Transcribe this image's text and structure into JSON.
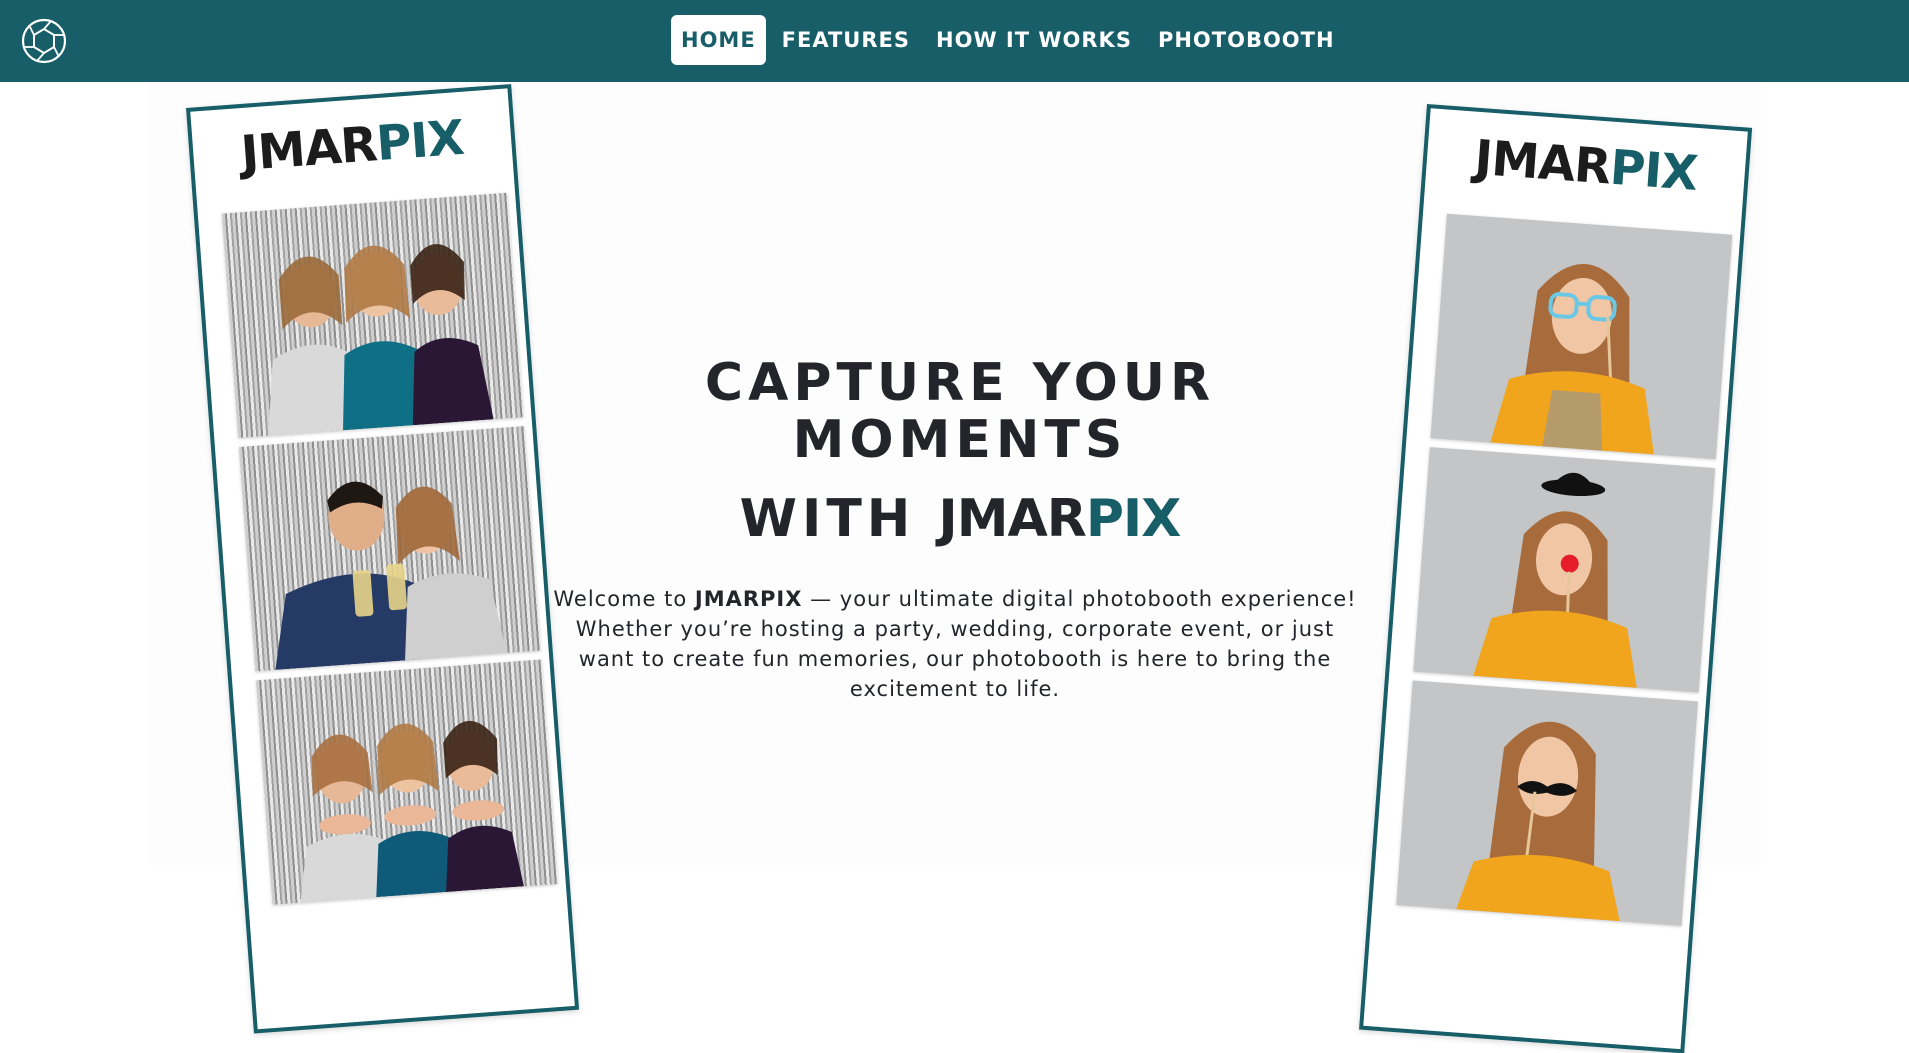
{
  "nav": {
    "items": [
      {
        "label": "HOME",
        "active": true
      },
      {
        "label": "FEATURES",
        "active": false
      },
      {
        "label": "HOW IT WORKS",
        "active": false
      },
      {
        "label": "PHOTOBOOTH",
        "active": false
      }
    ]
  },
  "brand": {
    "logo_icon": "camera-aperture-icon",
    "name_part1": "JMAR",
    "name_part2": "PIX"
  },
  "hero": {
    "line1": "CAPTURE YOUR MOMENTS",
    "line2_prefix": "WITH"
  },
  "intro": {
    "prefix": "Welcome to ",
    "brand": "JMARPIX",
    "text": " — your ultimate digital photobooth experience! Whether you’re hosting a party, wedding, corporate event, or just want to create fun memories, our photobooth is here to bring the excitement to life."
  },
  "colors": {
    "primary": "#175e68",
    "text": "#23252b",
    "background": "#ffffff"
  }
}
